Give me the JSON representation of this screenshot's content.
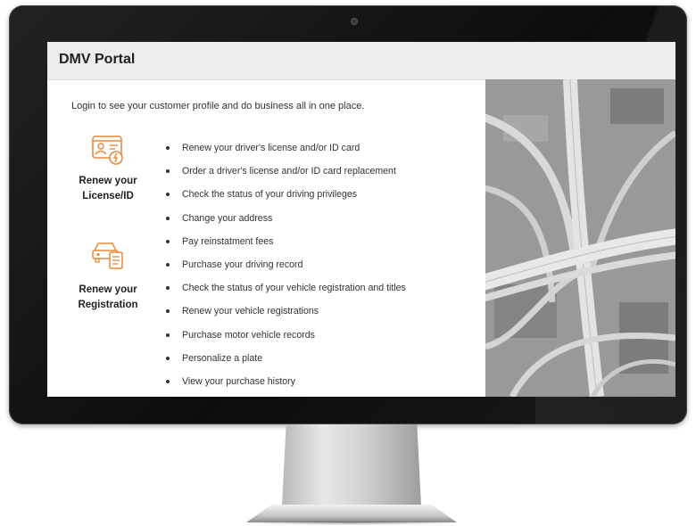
{
  "portal": {
    "title": "DMV Portal",
    "intro": "Login to see your customer profile and do business all in one place."
  },
  "features": [
    {
      "icon": "license-card-icon",
      "label_line1": "Renew your",
      "label_line2": "License/ID"
    },
    {
      "icon": "car-registration-icon",
      "label_line1": "Renew your",
      "label_line2": "Registration"
    }
  ],
  "services": [
    "Renew your driver's license and/or ID card",
    "Order a driver's license and/or ID card replacement",
    "Check the status of your driving privileges",
    "Change your address",
    "Pay reinstatment fees",
    "Purchase your driving record",
    "Check the status of your vehicle registration and titles",
    "Renew your vehicle registrations",
    "Purchase motor vehicle records",
    "Personalize a plate",
    "View your purchase history"
  ],
  "colors": {
    "accent": "#e8893a",
    "header_bg": "#ededed",
    "bezel": "#111111"
  }
}
